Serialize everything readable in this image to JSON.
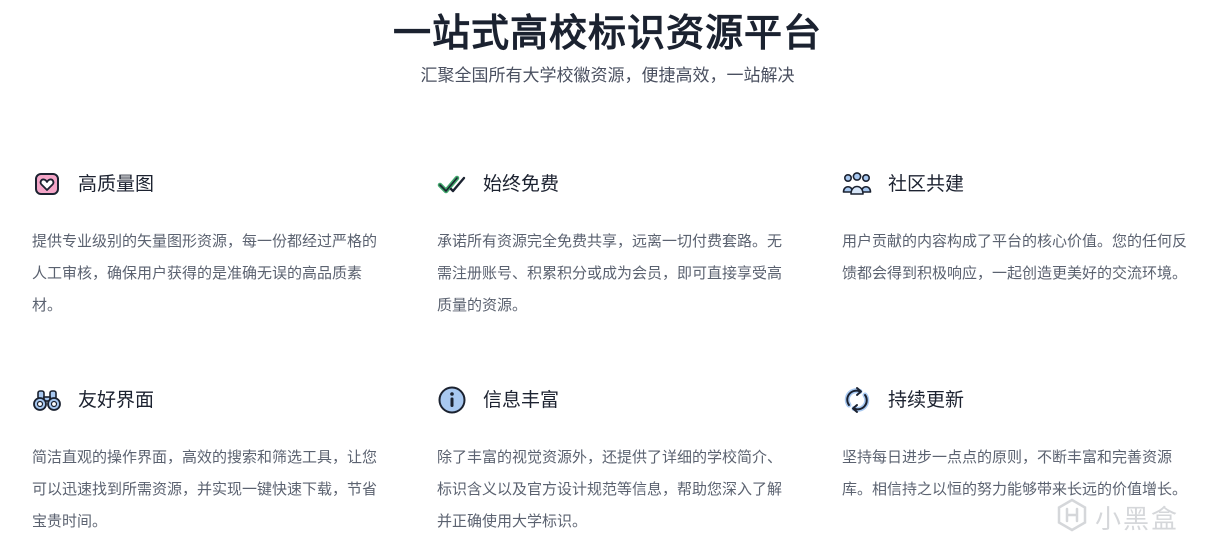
{
  "hero": {
    "title": "一站式高校标识资源平台",
    "subtitle": "汇聚全国所有大学校徽资源，便捷高效，一站解决"
  },
  "features": [
    {
      "icon": "heart-image-icon",
      "title": "高质量图",
      "description": "提供专业级别的矢量图形资源，每一份都经过严格的人工审核，确保用户获得的是准确无误的高品质素材。"
    },
    {
      "icon": "double-check-icon",
      "title": "始终免费",
      "description": "承诺所有资源完全免费共享，远离一切付费套路。无需注册账号、积累积分或成为会员，即可直接享受高质量的资源。"
    },
    {
      "icon": "community-people-icon",
      "title": "社区共建",
      "description": "用户贡献的内容构成了平台的核心价值。您的任何反馈都会得到积极响应，一起创造更美好的交流环境。"
    },
    {
      "icon": "binoculars-icon",
      "title": "友好界面",
      "description": "简洁直观的操作界面，高效的搜索和筛选工具，让您可以迅速找到所需资源，并实现一键快速下载，节省宝贵时间。"
    },
    {
      "icon": "info-circle-icon",
      "title": "信息丰富",
      "description": "除了丰富的视觉资源外，还提供了详细的学校简介、标识含义以及官方设计规范等信息，帮助您深入了解并正确使用大学标识。"
    },
    {
      "icon": "refresh-arrows-icon",
      "title": "持续更新",
      "description": "坚持每日进步一点点的原则，不断丰富和完善资源库。相信持之以恒的努力能够带来长远的价值增长。"
    }
  ],
  "watermark": {
    "text": "小黑盒"
  },
  "colors": {
    "icon_fill": "#a8c8f0",
    "icon_accent": "#f4a6c8",
    "icon_check": "#3fa66b",
    "icon_stroke": "#1b2230"
  }
}
